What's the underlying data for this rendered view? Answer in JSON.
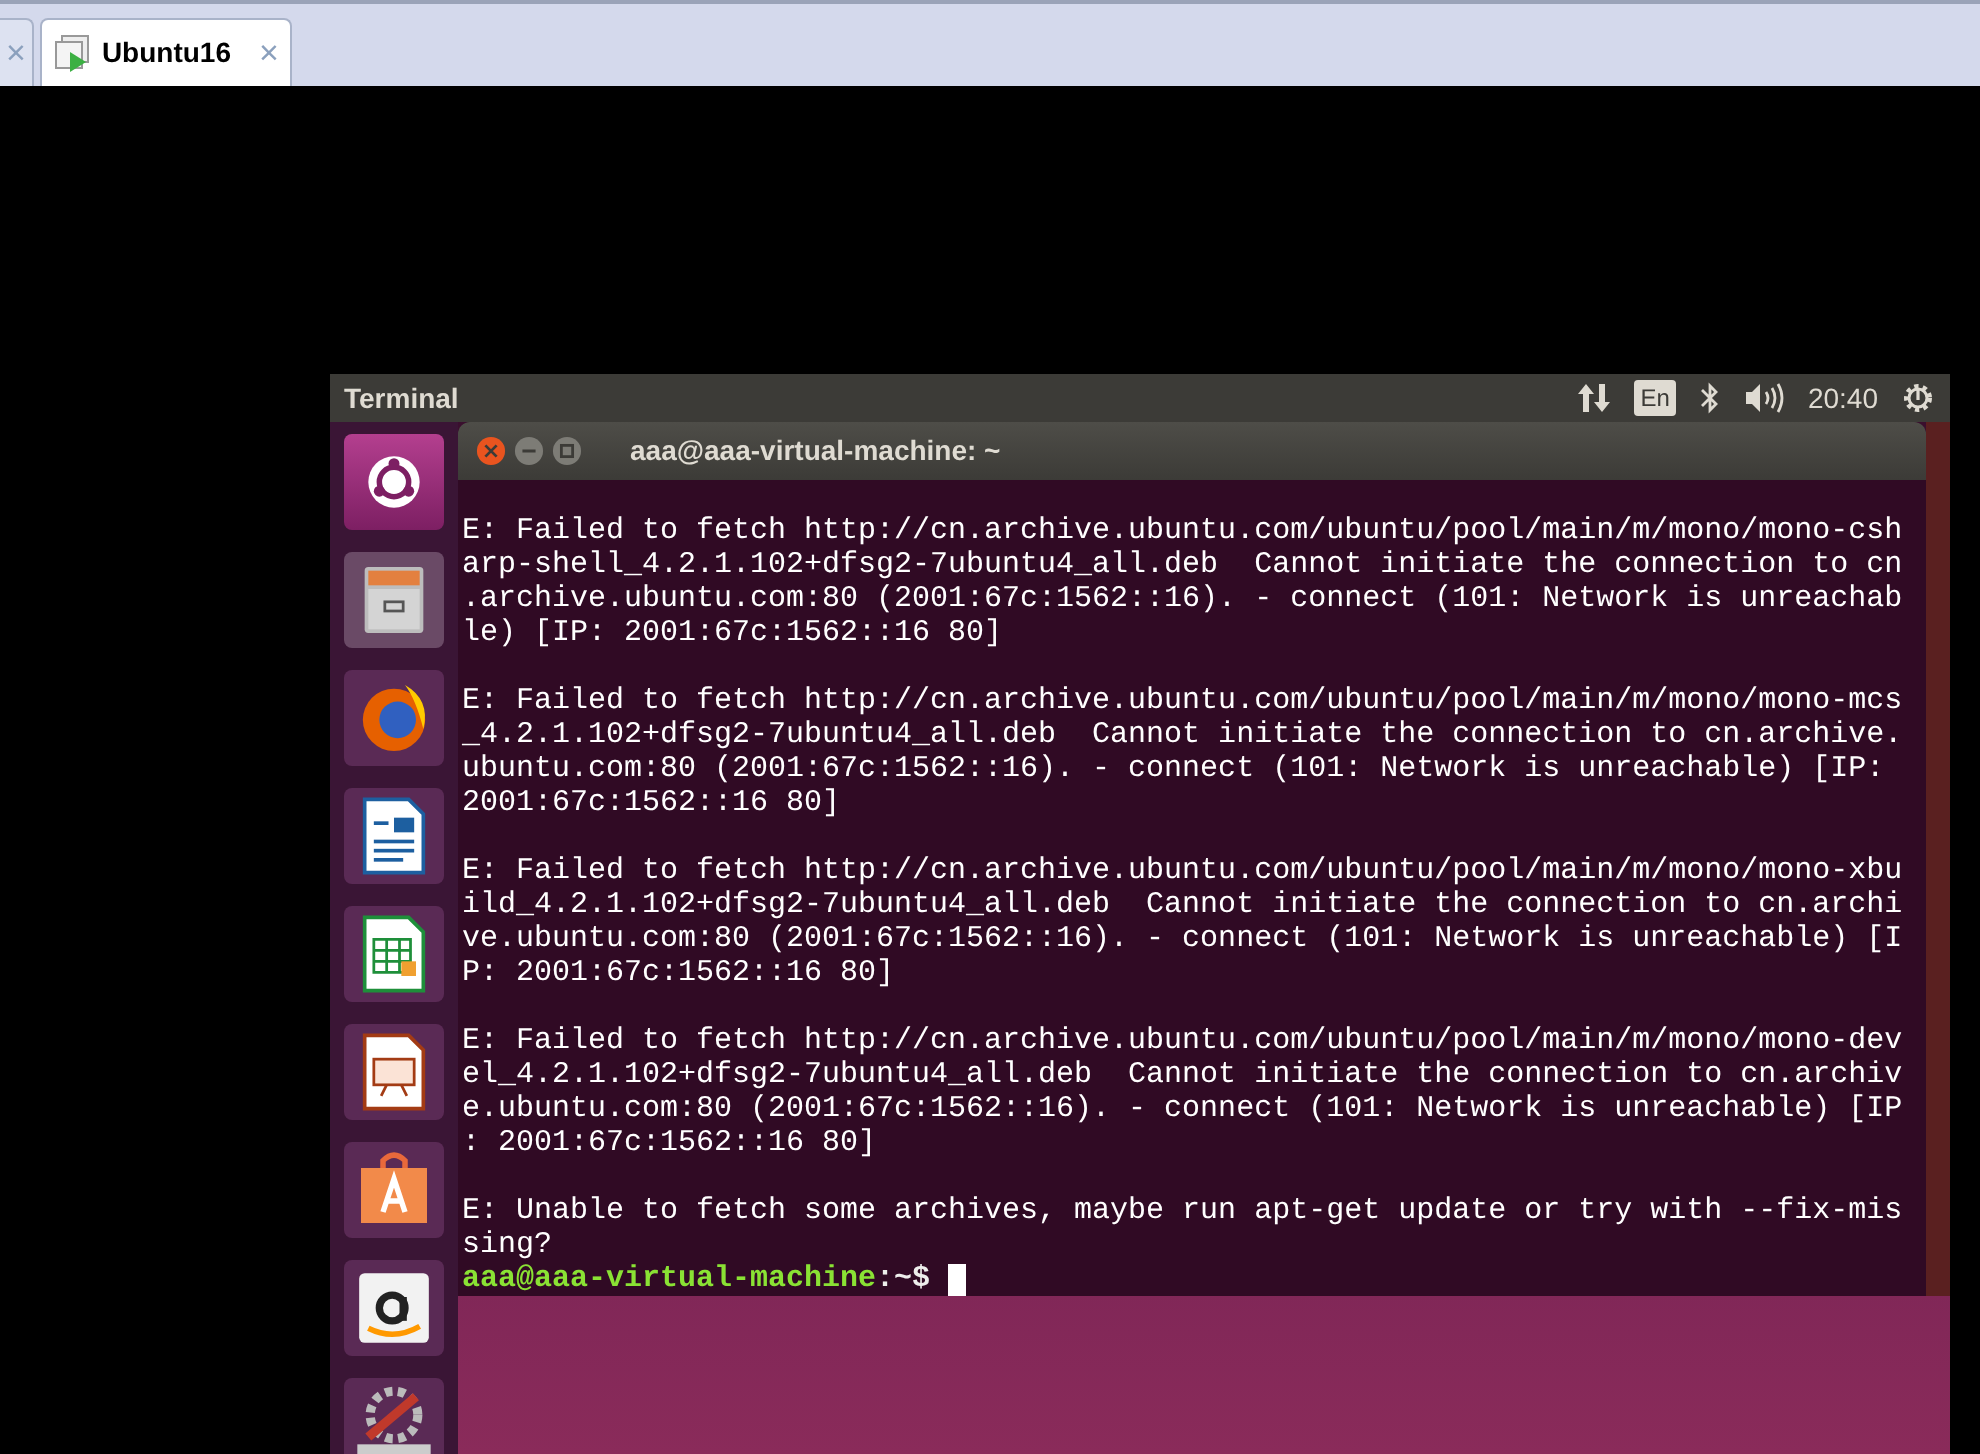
{
  "host_tabs": [
    {
      "close": "×",
      "selected": false
    },
    {
      "label": "Ubuntu16",
      "close": "×",
      "selected": true
    }
  ],
  "top_panel": {
    "app_title": "Terminal",
    "keyboard": "En",
    "clock": "20:40"
  },
  "launcher": [
    {
      "kind": "dash"
    },
    {
      "kind": "files"
    },
    {
      "kind": "browser"
    },
    {
      "kind": "writer"
    },
    {
      "kind": "calc"
    },
    {
      "kind": "impress"
    },
    {
      "kind": "store"
    },
    {
      "kind": "amazon"
    },
    {
      "kind": "settings"
    }
  ],
  "terminal": {
    "title": "aaa@aaa-virtual-machine: ~",
    "messages": [
      [
        "E: Failed to fetch http://cn.archive.ubuntu.com/ubuntu/pool/main/m/mono/mono-csh",
        "arp-shell_4.2.1.102+dfsg2-7ubuntu4_all.deb  Cannot initiate the connection to cn",
        ".archive.ubuntu.com:80 (2001:67c:1562::16). - connect (101: Network is unreachab",
        "le) [IP: 2001:67c:1562::16 80]"
      ],
      [
        "E: Failed to fetch http://cn.archive.ubuntu.com/ubuntu/pool/main/m/mono/mono-mcs",
        "_4.2.1.102+dfsg2-7ubuntu4_all.deb  Cannot initiate the connection to cn.archive.",
        "ubuntu.com:80 (2001:67c:1562::16). - connect (101: Network is unreachable) [IP:",
        "2001:67c:1562::16 80]"
      ],
      [
        "E: Failed to fetch http://cn.archive.ubuntu.com/ubuntu/pool/main/m/mono/mono-xbu",
        "ild_4.2.1.102+dfsg2-7ubuntu4_all.deb  Cannot initiate the connection to cn.archi",
        "ve.ubuntu.com:80 (2001:67c:1562::16). - connect (101: Network is unreachable) [I",
        "P: 2001:67c:1562::16 80]"
      ],
      [
        "E: Failed to fetch http://cn.archive.ubuntu.com/ubuntu/pool/main/m/mono/mono-dev",
        "el_4.2.1.102+dfsg2-7ubuntu4_all.deb  Cannot initiate the connection to cn.archiv",
        "e.ubuntu.com:80 (2001:67c:1562::16). - connect (101: Network is unreachable) [IP",
        ": 2001:67c:1562::16 80]"
      ],
      [
        "E: Unable to fetch some archives, maybe run apt-get update or try with --fix-mis",
        "sing?"
      ]
    ],
    "prompt": {
      "user_host": "aaa@aaa-virtual-machine",
      "path": ":~$"
    }
  }
}
